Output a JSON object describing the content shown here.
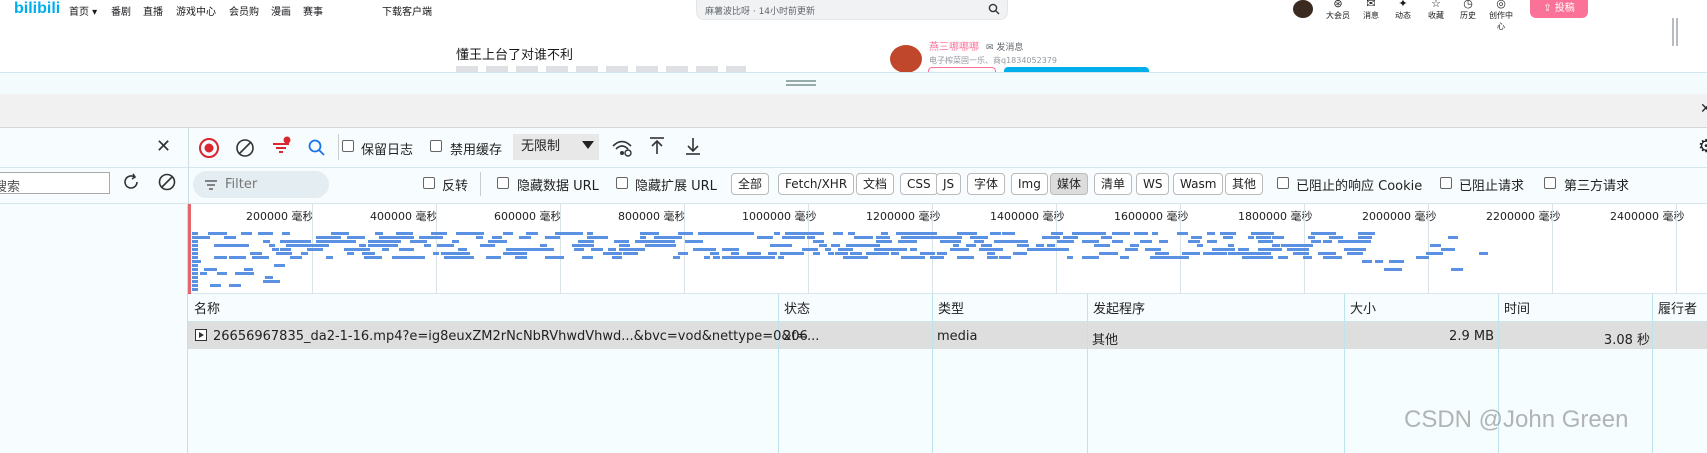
{
  "site": {
    "logo": "bilibili",
    "nav": [
      {
        "label": "首页 ▾",
        "name": "nav-home"
      },
      {
        "label": "番剧",
        "name": "nav-anime"
      },
      {
        "label": "直播",
        "name": "nav-live"
      },
      {
        "label": "游戏中心",
        "name": "nav-game-center"
      },
      {
        "label": "会员购",
        "name": "nav-vip-shop"
      },
      {
        "label": "漫画",
        "name": "nav-manga"
      },
      {
        "label": "赛事",
        "name": "nav-esports"
      },
      {
        "label": "下载客户端",
        "name": "nav-download-client"
      }
    ],
    "search_placeholder": "麻薯波比呀 · 14小时前更新",
    "user_icons": [
      {
        "label": "大会员",
        "name": "vip-icon",
        "glyph": "⊛"
      },
      {
        "label": "消息",
        "name": "message-icon",
        "glyph": "✉"
      },
      {
        "label": "动态",
        "name": "dynamics-icon",
        "glyph": "✦"
      },
      {
        "label": "收藏",
        "name": "favorites-icon",
        "glyph": "☆"
      },
      {
        "label": "历史",
        "name": "history-icon",
        "glyph": "◷"
      },
      {
        "label": "创作中心",
        "name": "creator-center-icon",
        "glyph": "◎"
      }
    ],
    "upload_label": "⇪ 投稿",
    "video_title": "懂王上台了对谁不利",
    "uploader_name": "燕三哪哪哪",
    "send_message": "✉ 发消息",
    "uploader_desc": "电子榨菜固一乐、商q1834052379"
  },
  "devtools": {
    "toolbar": {
      "preserve_log": "保留日志",
      "disable_cache": "禁用缓存",
      "throttle": "无限制"
    },
    "left_search_placeholder": "搜索",
    "filter_placeholder": "Filter",
    "filters": {
      "invert": "反转",
      "hide_data_url": "隐藏数据 URL",
      "hide_ext_url": "隐藏扩展 URL",
      "types": [
        "全部",
        "Fetch/XHR",
        "文档",
        "CSS",
        "JS",
        "字体",
        "Img",
        "媒体",
        "清单",
        "WS",
        "Wasm",
        "其他"
      ],
      "active_type": "媒体",
      "blocked_cookies": "已阻止的响应 Cookie",
      "blocked_requests": "已阻止请求",
      "third_party": "第三方请求"
    },
    "timeline_ticks": [
      "200000 毫秒",
      "400000 毫秒",
      "600000 毫秒",
      "800000 毫秒",
      "1000000 毫秒",
      "1200000 毫秒",
      "1400000 毫秒",
      "1600000 毫秒",
      "1800000 毫秒",
      "2000000 毫秒",
      "2200000 毫秒",
      "2400000 毫秒"
    ],
    "columns": [
      "名称",
      "状态",
      "类型",
      "发起程序",
      "大小",
      "时间",
      "履行者"
    ],
    "rows": [
      {
        "name": "26656967835_da2-1-16.mp4?e=ig8euxZM2rNcNbRVhwdVhwd...&bvc=vod&nettype=0&f=...",
        "status": "206",
        "type": "media",
        "initiator": "其他",
        "size": "2.9 MB",
        "time": "3.08 秒"
      }
    ]
  },
  "watermark": "CSDN @John Green",
  "colors": {
    "bilibili_blue": "#00aeec",
    "bilibili_pink": "#fb7299",
    "record_red": "#d9262f",
    "waterfall_blue": "#5b91e2"
  }
}
